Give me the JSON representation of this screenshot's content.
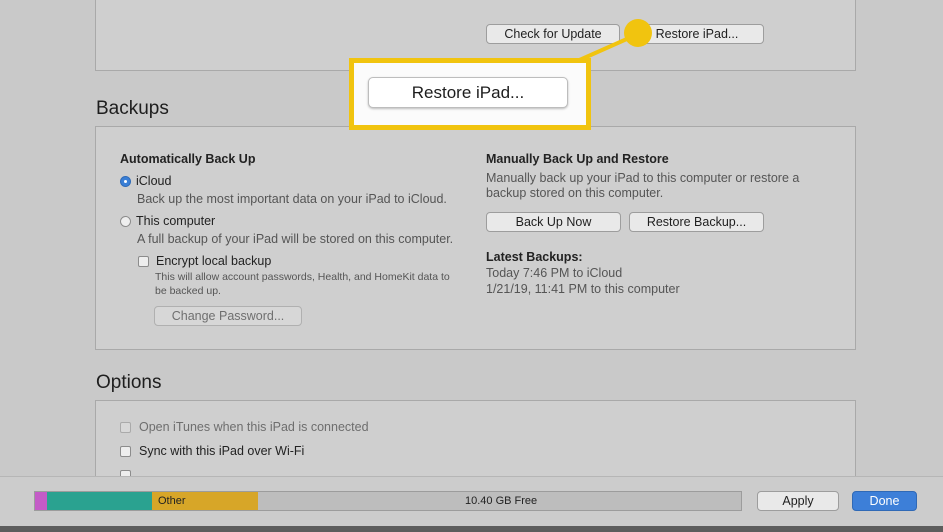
{
  "top": {
    "check_update": "Check for Update",
    "restore_ipad": "Restore iPad..."
  },
  "callout": {
    "label": "Restore iPad...",
    "accent": "#f1c40f"
  },
  "backups": {
    "title": "Backups",
    "auto_heading": "Automatically Back Up",
    "icloud_label": "iCloud",
    "icloud_desc": "Back up the most important data on your iPad to iCloud.",
    "computer_label": "This computer",
    "computer_desc": "A full backup of your iPad will be stored on this computer.",
    "encrypt_label": "Encrypt local backup",
    "encrypt_desc_1": "This will allow account passwords, Health, and HomeKit data to",
    "encrypt_desc_2": "be backed up.",
    "change_password": "Change Password...",
    "manual_heading": "Manually Back Up and Restore",
    "manual_desc_1": "Manually back up your iPad to this computer or restore a",
    "manual_desc_2": "backup stored on this computer.",
    "back_up_now": "Back Up Now",
    "restore_backup": "Restore Backup...",
    "latest_heading": "Latest Backups:",
    "latest_1": "Today 7:46 PM to iCloud",
    "latest_2": "1/21/19, 11:41 PM to this computer"
  },
  "options": {
    "title": "Options",
    "open_itunes": "Open iTunes when this iPad is connected",
    "sync_wifi": "Sync with this iPad over Wi-Fi"
  },
  "storage": {
    "other_label": "Other",
    "free_label": "10.40 GB Free",
    "colors": {
      "purple": "#c45bc7",
      "teal": "#2aa290",
      "other": "#d7a628",
      "free": "#bdbdbd"
    }
  },
  "bottom": {
    "apply": "Apply",
    "done": "Done"
  }
}
